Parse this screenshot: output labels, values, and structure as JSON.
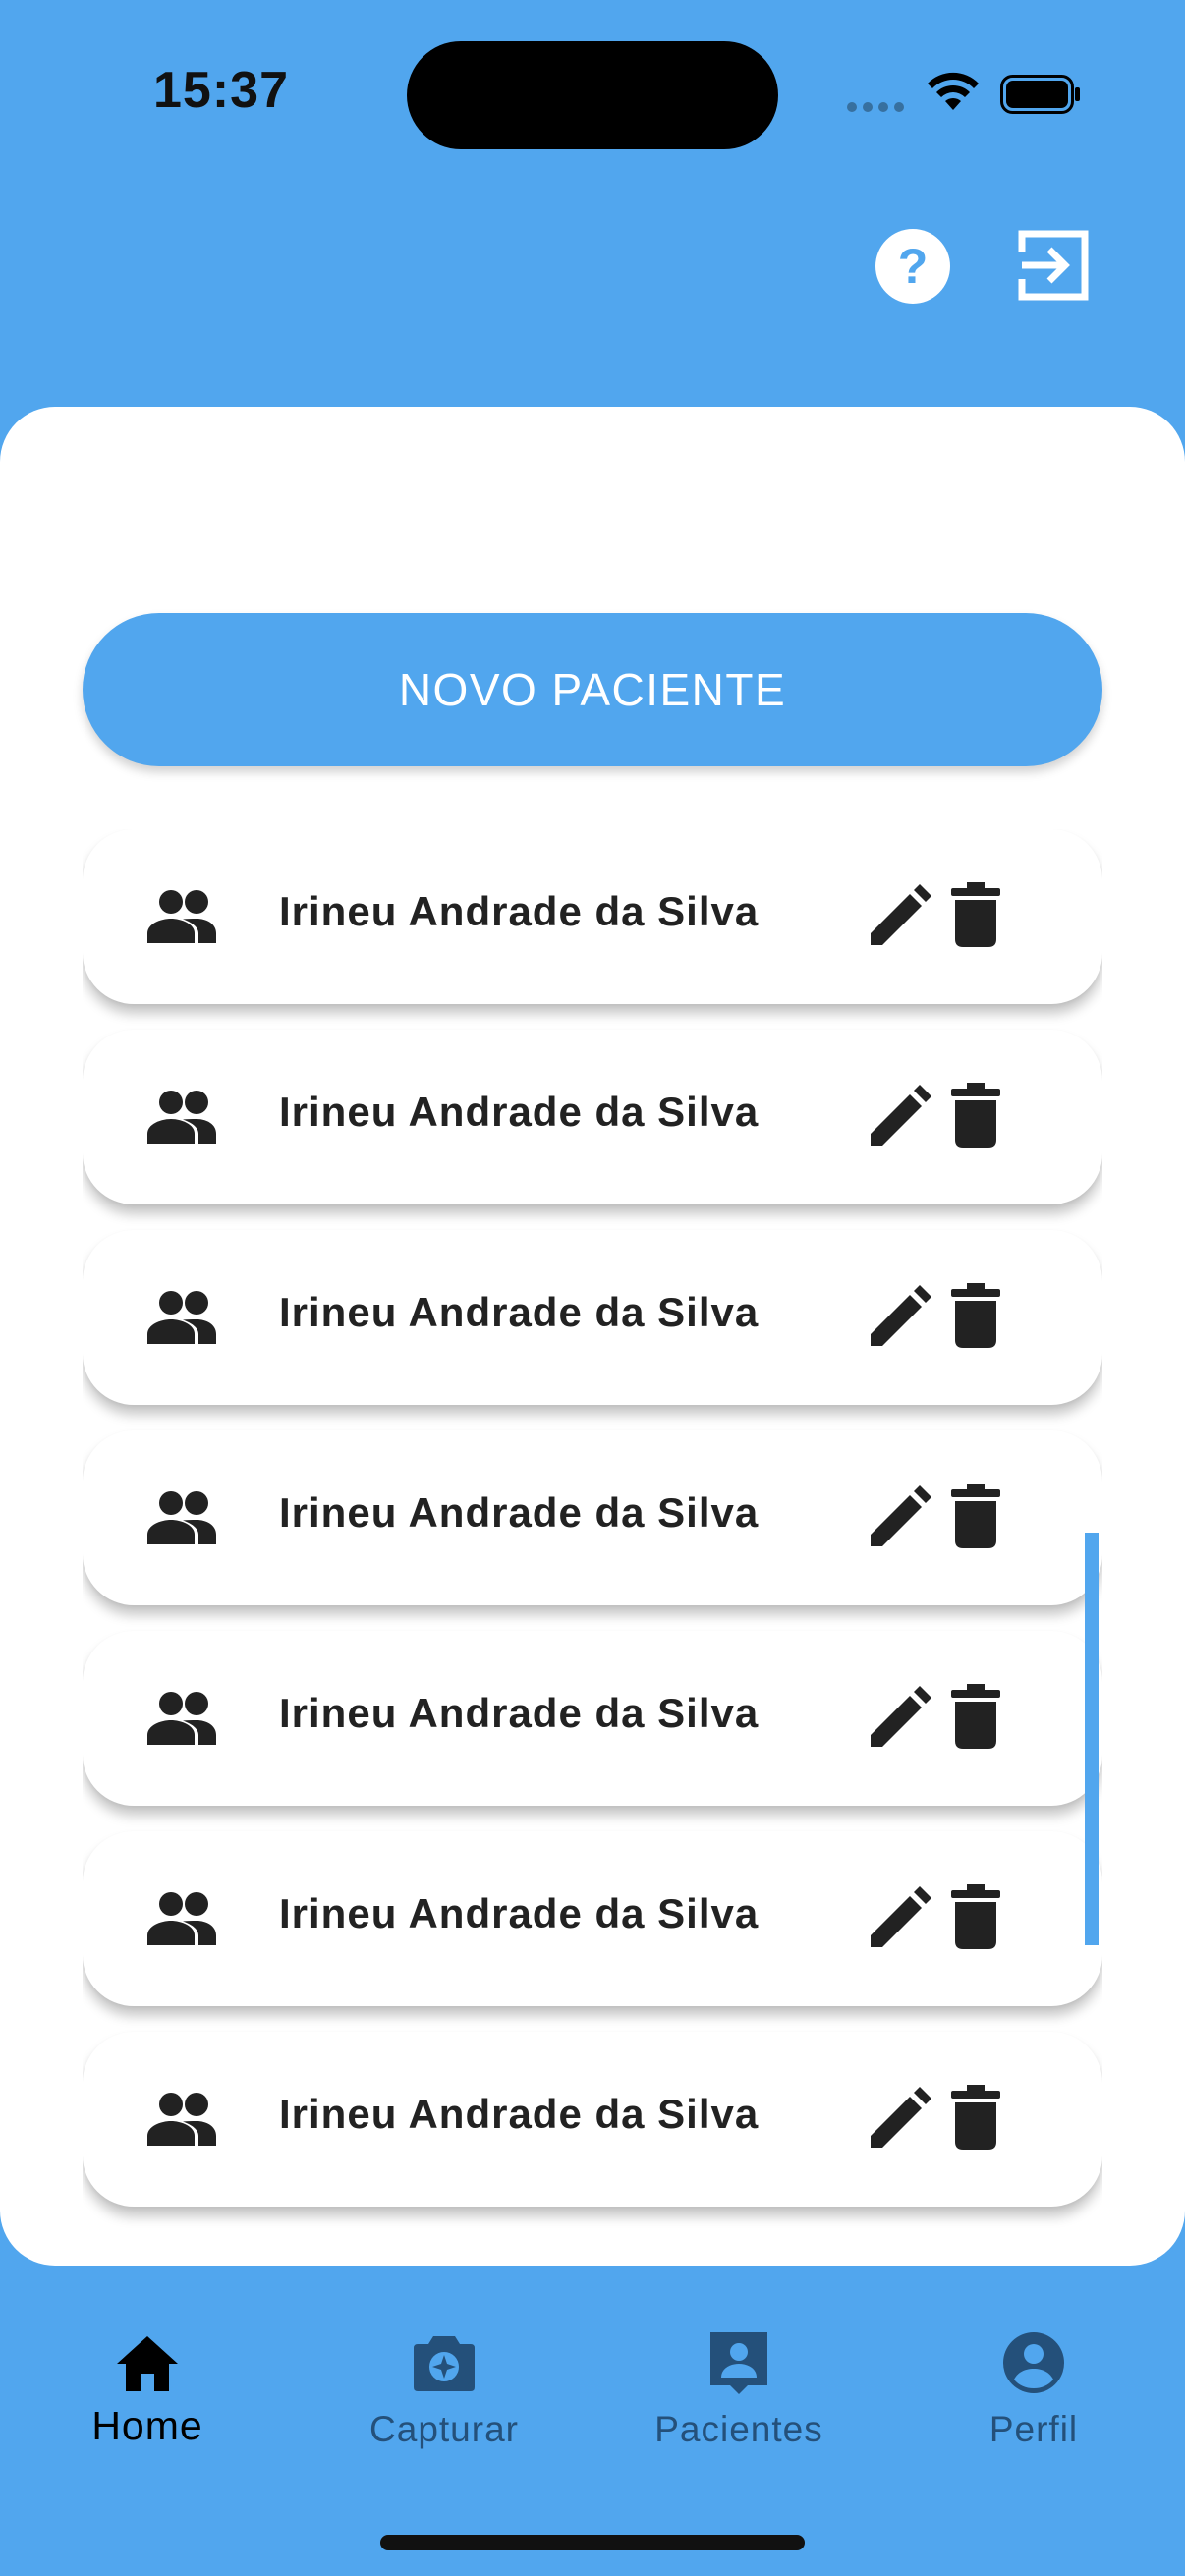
{
  "status_bar": {
    "time": "15:37"
  },
  "header": {
    "help_icon": "question-circle-icon",
    "logout_icon": "logout-icon"
  },
  "main": {
    "new_patient_label": "NOVO PACIENTE",
    "patients": [
      {
        "name": "Irineu Andrade da Silva"
      },
      {
        "name": "Irineu Andrade da Silva"
      },
      {
        "name": "Irineu Andrade da Silva"
      },
      {
        "name": "Irineu Andrade da Silva"
      },
      {
        "name": "Irineu Andrade da Silva"
      },
      {
        "name": "Irineu Andrade da Silva"
      },
      {
        "name": "Irineu Andrade da Silva"
      }
    ]
  },
  "bottom_nav": {
    "items": [
      {
        "label": "Home",
        "icon": "home-icon",
        "active": true
      },
      {
        "label": "Capturar",
        "icon": "camera-icon",
        "active": false
      },
      {
        "label": "Pacientes",
        "icon": "contact-icon",
        "active": false
      },
      {
        "label": "Perfil",
        "icon": "account-icon",
        "active": false
      }
    ]
  },
  "colors": {
    "accent": "#51A6EE",
    "card": "#FFFFFF",
    "text_dark": "#222222",
    "nav_inactive": "#24507A"
  }
}
